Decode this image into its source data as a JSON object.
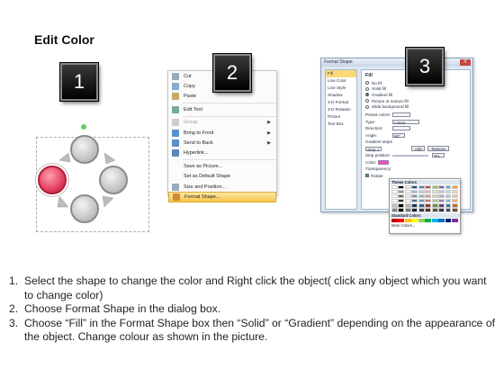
{
  "title": "Edit Color",
  "badges": [
    "1",
    "2",
    "3"
  ],
  "context_menu": {
    "items": [
      {
        "label": "Cut",
        "icon": "scissors-icon",
        "enabled": true,
        "submenu": false
      },
      {
        "label": "Copy",
        "icon": "copy-icon",
        "enabled": true,
        "submenu": false
      },
      {
        "label": "Paste",
        "icon": "paste-icon",
        "enabled": true,
        "submenu": false
      },
      {
        "label": "Edit Text",
        "icon": "edit-text-icon",
        "enabled": true,
        "submenu": false
      },
      {
        "label": "Group",
        "icon": "group-icon",
        "enabled": false,
        "submenu": true
      },
      {
        "label": "Bring to Front",
        "icon": "bring-front-icon",
        "enabled": true,
        "submenu": true
      },
      {
        "label": "Send to Back",
        "icon": "send-back-icon",
        "enabled": true,
        "submenu": true
      },
      {
        "label": "Hyperlink...",
        "icon": "hyperlink-icon",
        "enabled": true,
        "submenu": false
      },
      {
        "label": "Save as Picture...",
        "icon": "",
        "enabled": true,
        "submenu": false
      },
      {
        "label": "Set as Default Shape",
        "icon": "",
        "enabled": true,
        "submenu": false
      },
      {
        "label": "Size and Position...",
        "icon": "size-icon",
        "enabled": true,
        "submenu": false
      },
      {
        "label": "Format Shape...",
        "icon": "format-shape-icon",
        "enabled": true,
        "submenu": false,
        "highlighted": true
      }
    ]
  },
  "format_dialog": {
    "title": "Format Shape",
    "close_label": "X",
    "sidebar": [
      "Fill",
      "Line Color",
      "Line Style",
      "Shadow",
      "3-D Format",
      "3-D Rotation",
      "Picture",
      "Text Box"
    ],
    "selected_sidebar": "Fill",
    "heading": "Fill",
    "fill_options": [
      "No fill",
      "Solid fill",
      "Gradient fill",
      "Picture or texture fill",
      "Slide background fill"
    ],
    "selected_fill": "Gradient fill",
    "preset_colors_label": "Preset colors:",
    "type_label": "Type:",
    "type_value": "Linear",
    "direction_label": "Direction:",
    "angle_label": "Angle:",
    "angle_value": "90°",
    "gradient_stops_label": "Gradient stops",
    "stop_value": "Stop 1",
    "add_label": "Add",
    "remove_label": "Remove",
    "stop_position_label": "Stop position:",
    "stop_position_value": "0%",
    "color_label": "Color:",
    "transparency_label": "Transparency:",
    "rotate_label": "Rotate"
  },
  "color_palette": {
    "theme_header": "Theme Colors",
    "standard_header": "Standard Colors",
    "more_colors": "More Colors...",
    "theme_top": [
      "#ffffff",
      "#000000",
      "#eeece1",
      "#1f497d",
      "#4f81bd",
      "#c0504d",
      "#9bbb59",
      "#8064a2",
      "#4bacc6",
      "#f79646"
    ],
    "standard": [
      "#c00000",
      "#ff0000",
      "#ffc000",
      "#ffff00",
      "#92d050",
      "#00b050",
      "#00b0f0",
      "#0070c0",
      "#002060",
      "#7030a0"
    ]
  },
  "steps": [
    {
      "num": "1.",
      "text": "Select the shape to change the color and Right click the object( click any object which you want to change color)"
    },
    {
      "num": "2.",
      "text": "Choose Format Shape in the dialog box."
    },
    {
      "num": "3.",
      "text": "Choose “Fill” in the Format Shape box then “Solid” or “Gradient” depending on the appearance of the object. Change colour as shown in the picture."
    }
  ]
}
